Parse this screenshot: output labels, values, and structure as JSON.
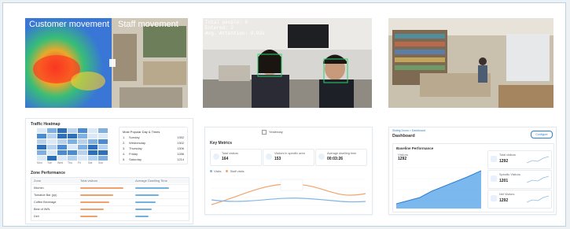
{
  "panel1": {
    "overlay_left": "Customer movement",
    "overlay_right": "Staff movement",
    "heatmap_title": "Traffic Heatmap",
    "heatmap_days": [
      "Mon",
      "Tue",
      "Wed",
      "Thu",
      "Fri",
      "Sat",
      "Sun"
    ],
    "peak_title": "Most Popular Day & Times",
    "peak_rows": [
      {
        "rank": "1.",
        "day": "Sunday",
        "count": "1352"
      },
      {
        "rank": "2.",
        "day": "Wednesday",
        "count": "1302"
      },
      {
        "rank": "3.",
        "day": "Thursday",
        "count": "1306"
      },
      {
        "rank": "4.",
        "day": "Friday",
        "count": "1286"
      },
      {
        "rank": "5.",
        "day": "Saturday",
        "count": "1214"
      }
    ],
    "zone_title": "Zone Performance",
    "zone_headers": [
      "Zone",
      "Total visitors",
      "Average Dwelling Time"
    ],
    "zone_rows": [
      {
        "zone": "Kitchen",
        "visitors": 0.92,
        "dwell": 0.78
      },
      {
        "zone": "Tomatoe Bar (pp)",
        "visitors": 0.7,
        "dwell": 0.55
      },
      {
        "zone": "Coffee Beverage",
        "visitors": 0.62,
        "dwell": 0.48
      },
      {
        "zone": "Best of IWN",
        "visitors": 0.5,
        "dwell": 0.38
      },
      {
        "zone": "Deli",
        "visitors": 0.36,
        "dwell": 0.3
      }
    ]
  },
  "panel2": {
    "overlay_lines": [
      "Total people: 9",
      "Entered: 2",
      "Avg. Attention: 0.93s"
    ],
    "date_label": "Yesterday",
    "metrics_title": "Key Metrics",
    "metrics": [
      {
        "label": "Total visitors",
        "value": "164"
      },
      {
        "label": "Visitors in specific area",
        "value": "153"
      },
      {
        "label": "Average dwelling time",
        "value": "00:03:26"
      }
    ],
    "legend": [
      "Visits",
      "Staff visits"
    ],
    "colors": {
      "line_a": "#f2a36b",
      "line_b": "#7fb5e6",
      "accent": "#3b8fe0"
    }
  },
  "panel3": {
    "breadcrumb": "Sliding Doors > Dashboard",
    "title": "Dashboard",
    "configure_label": "Configure",
    "baseline_title": "Baseline Performance",
    "visitors_label": "Visitors",
    "visitors_value": "1292",
    "kpis": [
      {
        "label": "Total visitors",
        "value": "1292"
      },
      {
        "label": "Specific Visitors",
        "value": "1201"
      },
      {
        "label": "Net Visitors",
        "value": "1292"
      }
    ],
    "colors": {
      "area": "#5aa6e8",
      "accent": "#2f7fd1"
    }
  }
}
